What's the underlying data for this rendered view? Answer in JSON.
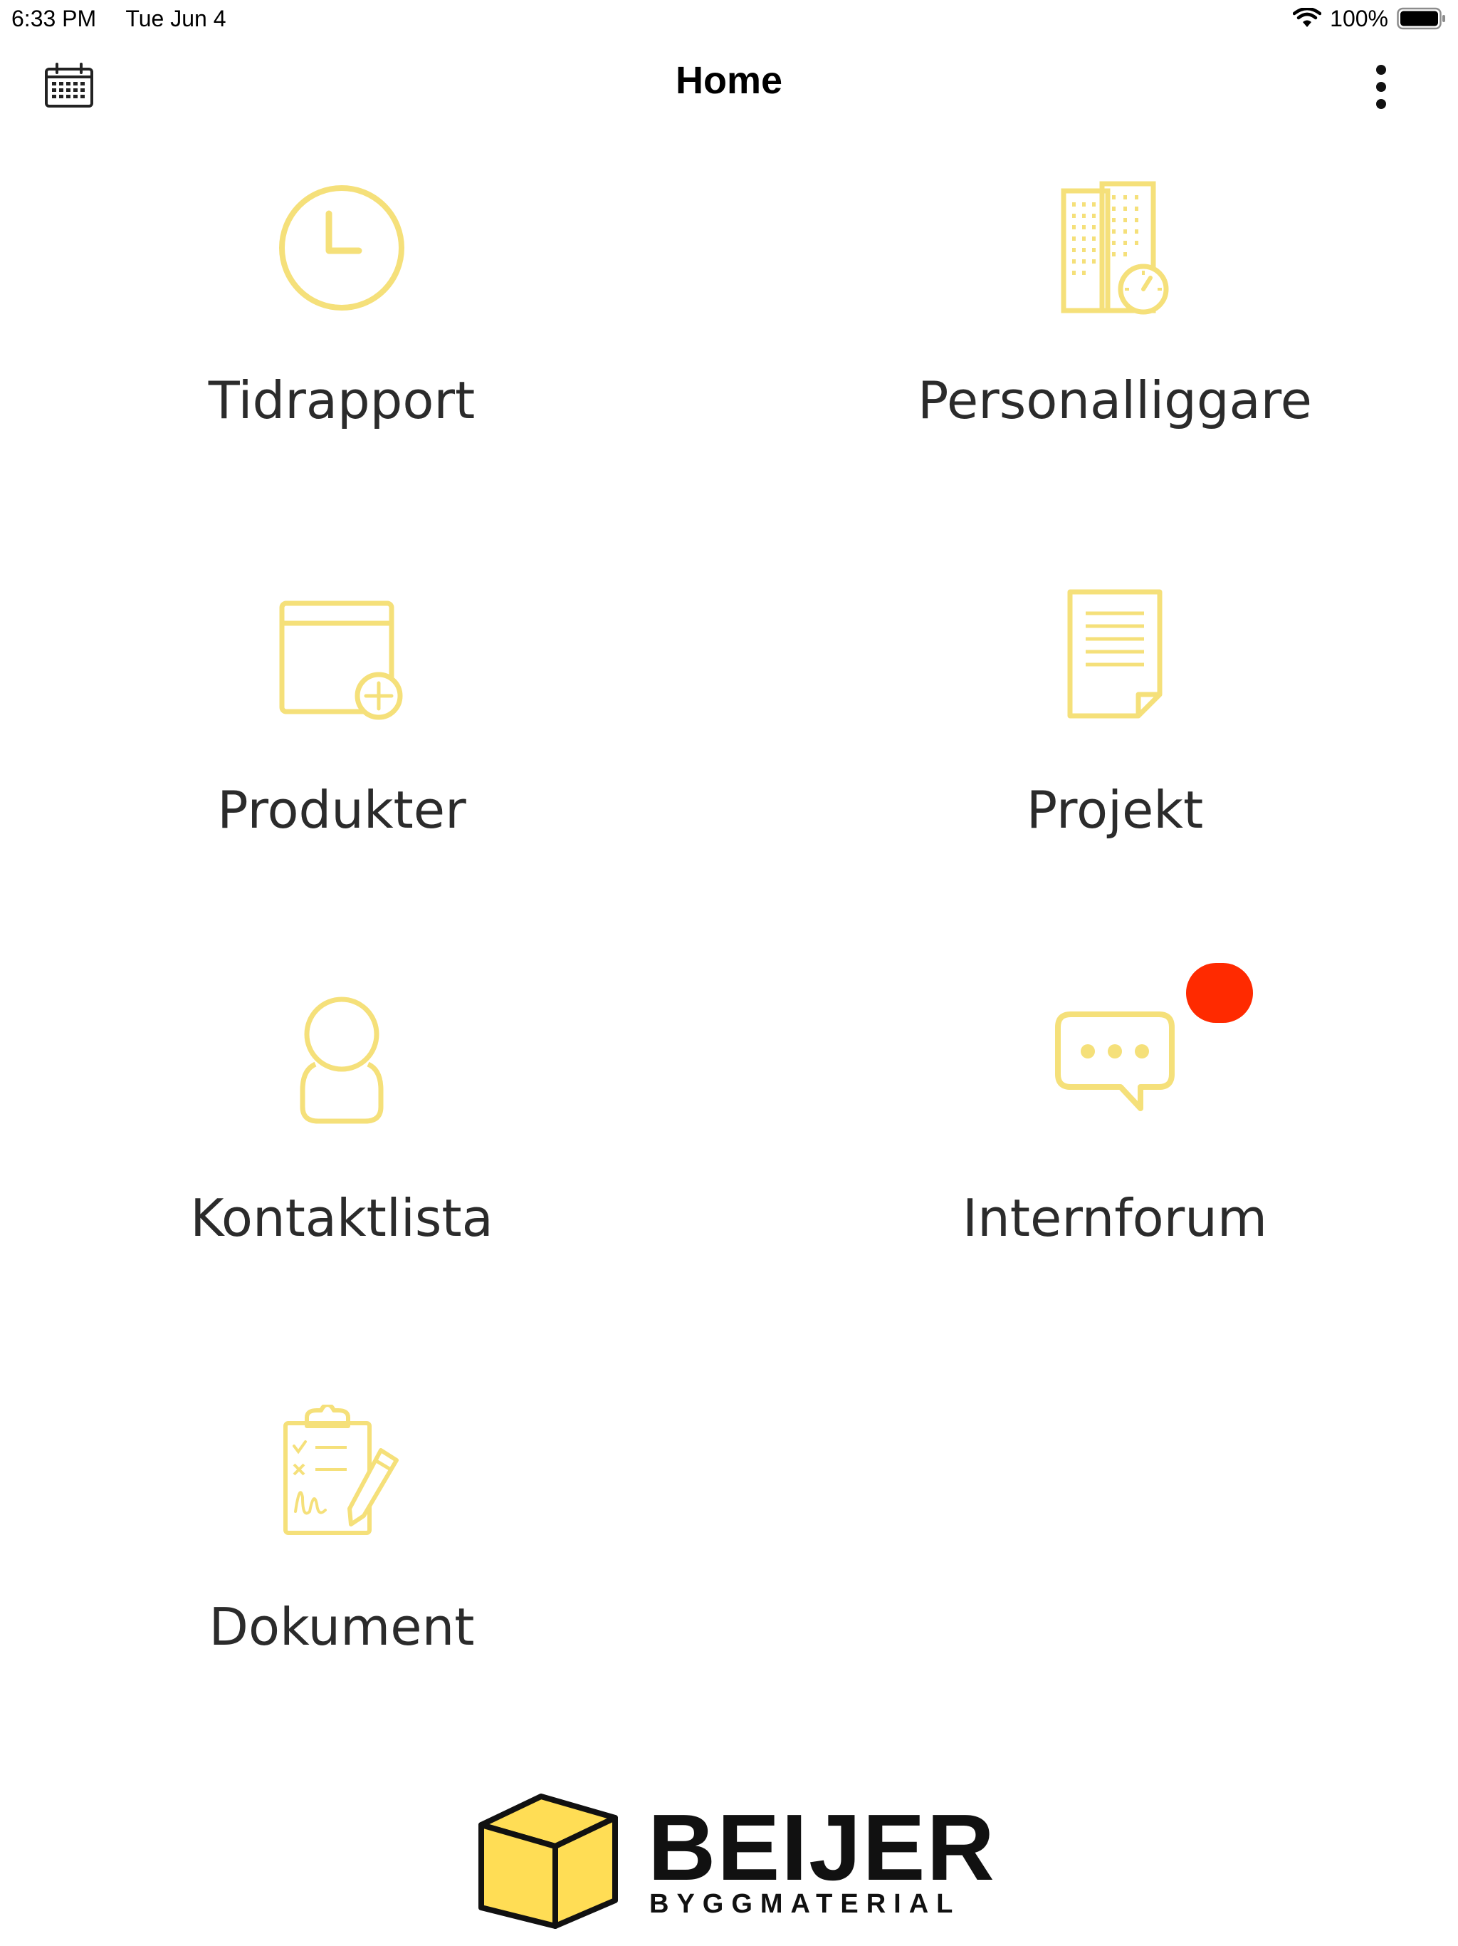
{
  "status_bar": {
    "time": "6:33 PM",
    "date": "Tue Jun 4",
    "battery": "100%"
  },
  "nav": {
    "title": "Home"
  },
  "tiles": [
    {
      "label": "Tidrapport",
      "icon": "clock-icon"
    },
    {
      "label": "Personalliggare",
      "icon": "building-timer-icon"
    },
    {
      "label": "Produkter",
      "icon": "window-add-icon"
    },
    {
      "label": "Projekt",
      "icon": "document-icon"
    },
    {
      "label": "Kontaktlista",
      "icon": "person-icon"
    },
    {
      "label": "Internforum",
      "icon": "chat-bubble-icon",
      "has_badge": true
    },
    {
      "label": "Dokument",
      "icon": "clipboard-sign-icon"
    }
  ],
  "logo": {
    "name": "BEIJER",
    "tagline": "BYGGMATERIAL"
  },
  "colors": {
    "icon": "#f5e07a",
    "badge": "#ff2a00",
    "logo_cube": "#ffdd55",
    "text": "#2b2b2b"
  }
}
